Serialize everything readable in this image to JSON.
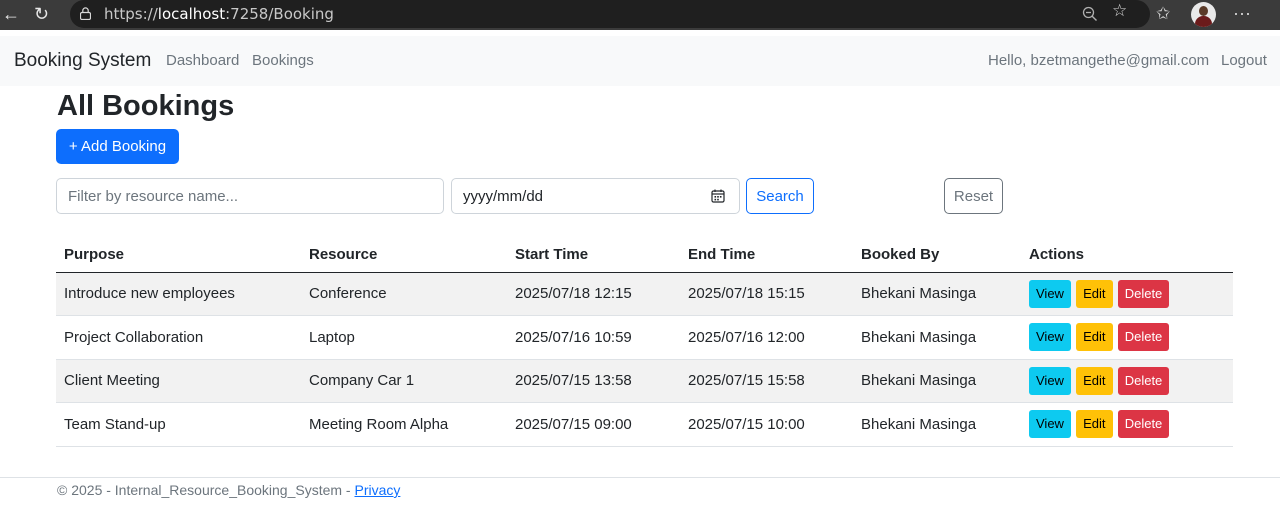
{
  "browser": {
    "url_prefix": "https://",
    "url_host": "localhost",
    "url_rest": ":7258/Booking"
  },
  "navbar": {
    "brand": "Booking System",
    "links": [
      "Dashboard",
      "Bookings"
    ],
    "greeting": "Hello, bzetmangethe@gmail.com",
    "logout": "Logout"
  },
  "page": {
    "title": "All Bookings",
    "add_button": "+ Add Booking"
  },
  "filters": {
    "resource_placeholder": "Filter by resource name...",
    "date_value": "yyyy/mm/dd",
    "search_label": "Search",
    "reset_label": "Reset"
  },
  "table": {
    "headers": [
      "Purpose",
      "Resource",
      "Start Time",
      "End Time",
      "Booked By",
      "Actions"
    ],
    "rows": [
      {
        "purpose": "Introduce new employees",
        "resource": "Conference",
        "start": "2025/07/18 12:15",
        "end": "2025/07/18 15:15",
        "booked_by": "Bhekani Masinga"
      },
      {
        "purpose": "Project Collaboration",
        "resource": "Laptop",
        "start": "2025/07/16 10:59",
        "end": "2025/07/16 12:00",
        "booked_by": "Bhekani Masinga"
      },
      {
        "purpose": "Client Meeting",
        "resource": "Company Car 1",
        "start": "2025/07/15 13:58",
        "end": "2025/07/15 15:58",
        "booked_by": "Bhekani Masinga"
      },
      {
        "purpose": "Team Stand-up",
        "resource": "Meeting Room Alpha",
        "start": "2025/07/15 09:00",
        "end": "2025/07/15 10:00",
        "booked_by": "Bhekani Masinga"
      }
    ],
    "action_labels": {
      "view": "View",
      "edit": "Edit",
      "delete": "Delete"
    }
  },
  "footer": {
    "text": "© 2025 - Internal_Resource_Booking_System - ",
    "privacy": "Privacy"
  },
  "colors": {
    "primary": "#0d6efd",
    "info": "#0dcaf0",
    "warning": "#ffc107",
    "danger": "#dc3545"
  }
}
